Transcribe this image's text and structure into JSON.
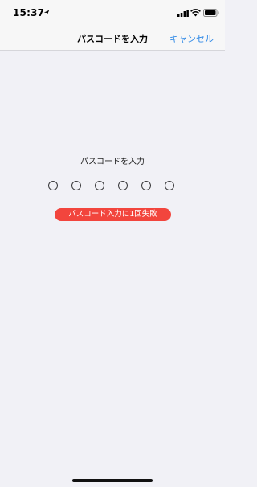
{
  "status_bar": {
    "time": "15:37",
    "icons": [
      "location-arrow-icon",
      "cellular-signal-icon",
      "wifi-icon",
      "battery-icon"
    ]
  },
  "nav": {
    "title": "パスコードを入力",
    "cancel_label": "キャンセル"
  },
  "passcode": {
    "prompt": "パスコードを入力",
    "digits_total": 6,
    "digits_entered": 0,
    "error": "パスコード入力に1回失敗"
  },
  "colors": {
    "accent": "#2f89e6",
    "error": "#f2453d",
    "background": "#f1f1f6"
  }
}
